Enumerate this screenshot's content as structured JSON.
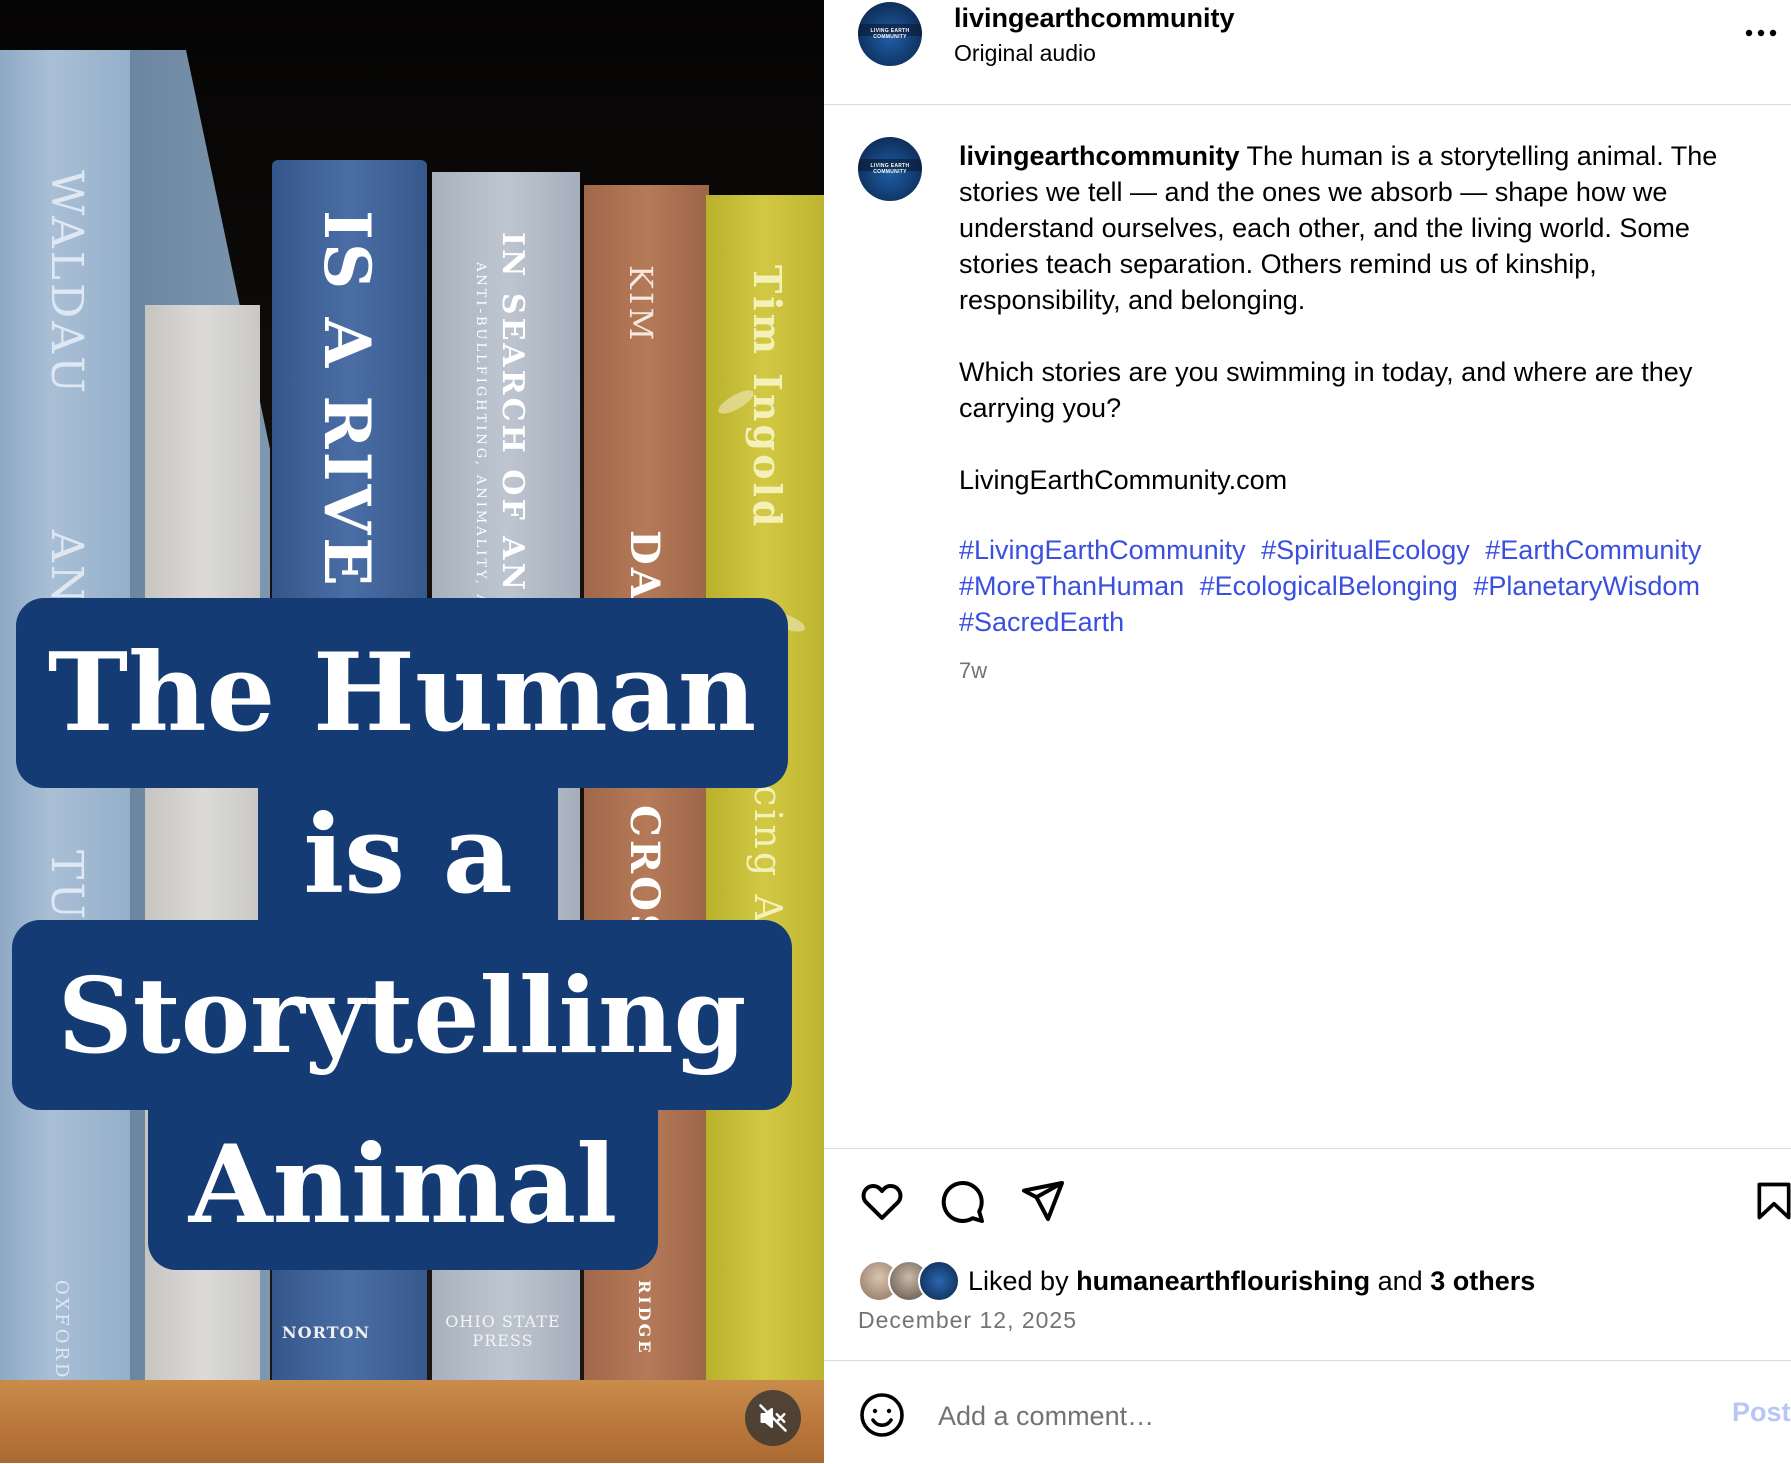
{
  "video": {
    "overlay_lines": [
      "The Human",
      "is a",
      "Storytelling",
      "Animal"
    ],
    "book_spines": [
      "WALDAU",
      "ANI",
      "TUD",
      "OXFORD",
      "IS A RIVE",
      "NORTON",
      "IN SEARCH OF AN A",
      "ANTI-BULLFIGHTING, ANIMALITY, A",
      "OHIO STATE PRESS",
      "KIM",
      "DA",
      "CROS",
      "RIDGE",
      "Tim Ingold",
      "cing A"
    ],
    "mute_icon": "speaker-muted-icon"
  },
  "header": {
    "username": "livingearthcommunity",
    "audio": "Original audio",
    "more_icon": "more-options-icon",
    "avatar_text": "LIVING EARTH COMMUNITY"
  },
  "caption": {
    "username": "livingearthcommunity",
    "text": " The human is a storytelling animal. The stories we tell — and the ones we absorb — shape how we understand ourselves, each other, and the living world. Some stories teach separation. Others remind us of kinship, responsibility, and belonging.\n\nWhich stories are you swimming in today, and where are they carrying you?\n\nLivingEarthCommunity.com",
    "hashtags": [
      "#LivingEarthCommunity",
      "#SpiritualEcology",
      "#EarthCommunity",
      "#MoreThanHuman",
      "#EcologicalBelonging",
      "#PlanetaryWisdom",
      "#SacredEarth"
    ],
    "time_ago": "7w"
  },
  "actions": {
    "icons": [
      "heart-icon",
      "comment-icon",
      "share-icon",
      "bookmark-icon"
    ],
    "liked_by_prefix": "Liked by",
    "liked_by_user": "humanearthflourishing",
    "liked_by_and": "and",
    "liked_by_others": "3 others",
    "date": "December 12, 2025"
  },
  "comment": {
    "placeholder": "Add a comment…",
    "post_label": "Post",
    "emoji_icon": "emoji-icon"
  },
  "colors": {
    "hashtag": "#3a4fe0",
    "overlay_box": "#143b73",
    "muted_text": "#737373",
    "post_disabled": "#b7c6f7"
  }
}
